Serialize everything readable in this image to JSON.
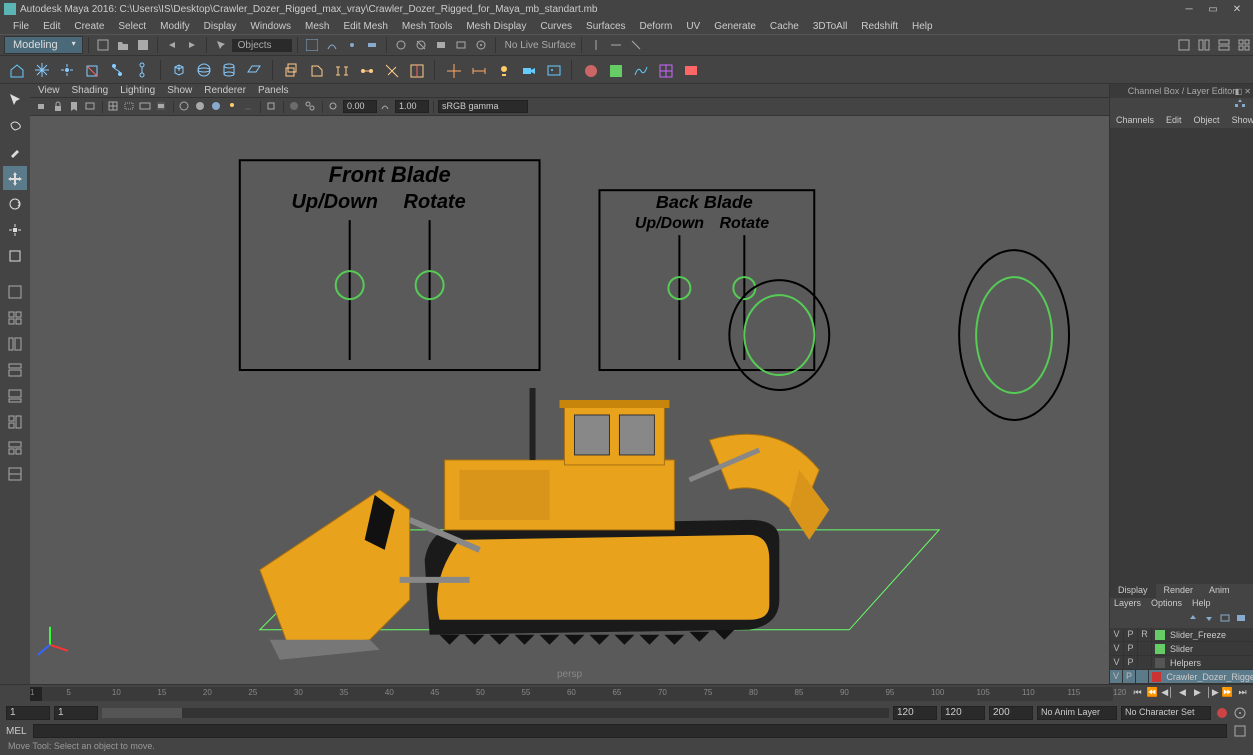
{
  "title": "Autodesk Maya 2016: C:\\Users\\IS\\Desktop\\Crawler_Dozer_Rigged_max_vray\\Crawler_Dozer_Rigged_for_Maya_mb_standart.mb",
  "main_menu": [
    "File",
    "Edit",
    "Create",
    "Select",
    "Modify",
    "Display",
    "Windows",
    "Mesh",
    "Edit Mesh",
    "Mesh Tools",
    "Mesh Display",
    "Curves",
    "Surfaces",
    "Deform",
    "UV",
    "Generate",
    "Cache",
    "3DToAll",
    "Redshift",
    "Help"
  ],
  "mode_menu": "Modeling",
  "objects_field": "Objects",
  "live_surface": "No Live Surface",
  "panel_menu": [
    "View",
    "Shading",
    "Lighting",
    "Show",
    "Renderer",
    "Panels"
  ],
  "near_clip": "0.00",
  "field_b": "1.00",
  "gamma_select": "sRGB gamma",
  "viewport": {
    "camera": "persp",
    "front_blade": {
      "title": "Front Blade",
      "sub1": "Up/Down",
      "sub2": "Rotate"
    },
    "back_blade": {
      "title": "Back Blade",
      "sub1": "Up/Down",
      "sub2": "Rotate"
    }
  },
  "channel_box": {
    "title": "Channel Box / Layer Editor",
    "tabs": [
      "Channels",
      "Edit",
      "Object",
      "Show"
    ],
    "display_tabs": [
      "Display",
      "Render",
      "Anim"
    ],
    "layers_menu": [
      "Layers",
      "Options",
      "Help"
    ],
    "layers": [
      {
        "v": "V",
        "p": "P",
        "r": "R",
        "color": "#66cc66",
        "name": "Slider_Freeze",
        "selected": false
      },
      {
        "v": "V",
        "p": "P",
        "r": "",
        "color": "#66cc66",
        "name": "Slider",
        "selected": false
      },
      {
        "v": "V",
        "p": "P",
        "r": "",
        "color": "",
        "name": "Helpers",
        "selected": false
      },
      {
        "v": "V",
        "p": "P",
        "r": "",
        "color": "#cc3333",
        "name": "Crawler_Dozer_Rigged",
        "selected": true
      }
    ]
  },
  "timeline": {
    "ticks": [
      1,
      5,
      10,
      15,
      20,
      25,
      30,
      35,
      40,
      45,
      50,
      55,
      60,
      65,
      70,
      75,
      80,
      85,
      90,
      95,
      100,
      105,
      110,
      115,
      120
    ],
    "current": 1,
    "start_field": "1",
    "start2_field": "1",
    "current_field": "1",
    "end_field": "120",
    "end2_field": "120",
    "range_end": "200",
    "anim_layer": "No Anim Layer",
    "char_set": "No Character Set"
  },
  "cmd_label": "MEL",
  "status_text": "Move Tool: Select an object to move."
}
